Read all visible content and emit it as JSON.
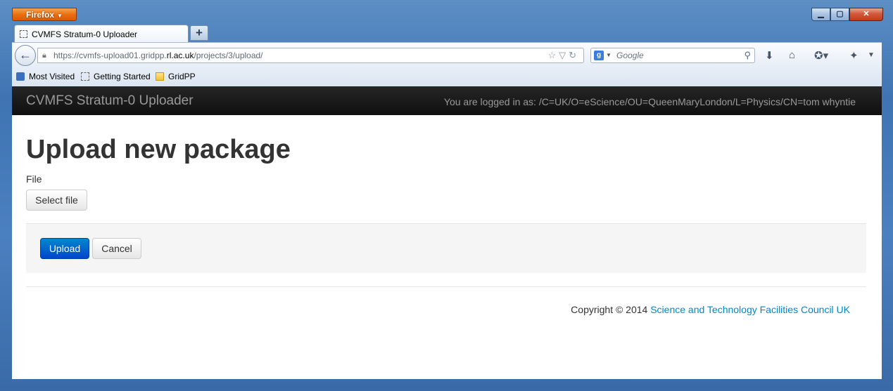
{
  "browser": {
    "menu_label": "Firefox",
    "window_controls": {
      "minimize": "▁",
      "maximize": "▢",
      "close": "✕"
    },
    "tab": {
      "title": "CVMFS Stratum-0 Uploader",
      "new_tab_label": "+"
    },
    "url": {
      "prefix": "https://cvmfs-upload01.gridpp.",
      "domain": "rl.ac.uk",
      "path": "/projects/3/upload/"
    },
    "search": {
      "placeholder": "Google",
      "engine_label": "g"
    },
    "bookmarks": [
      {
        "label": "Most Visited"
      },
      {
        "label": "Getting Started"
      },
      {
        "label": "GridPP"
      }
    ]
  },
  "page": {
    "brand": "CVMFS Stratum-0 Uploader",
    "login_text": "You are logged in as: /C=UK/O=eScience/OU=QueenMaryLondon/L=Physics/CN=tom whyntie",
    "heading": "Upload new package",
    "file_label": "File",
    "select_file_label": "Select file",
    "upload_label": "Upload",
    "cancel_label": "Cancel",
    "footer": {
      "copyright": "Copyright © 2014 ",
      "link_text": "Science and Technology Facilities Council UK"
    }
  }
}
